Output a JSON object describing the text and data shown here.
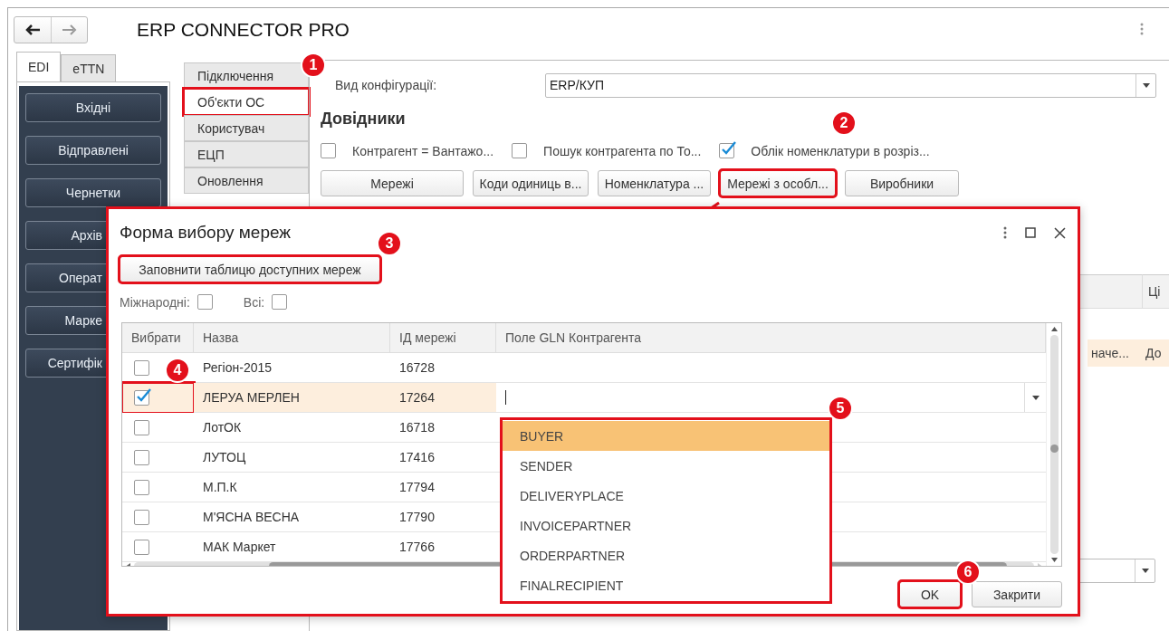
{
  "window": {
    "title": "ERP CONNECTOR PRO"
  },
  "top_tabs": [
    {
      "label": "EDI",
      "selected": true
    },
    {
      "label": "eTTN",
      "selected": false
    }
  ],
  "sidebar": {
    "items": [
      {
        "label": "Вхідні"
      },
      {
        "label": "Відправлені"
      },
      {
        "label": "Чернетки"
      },
      {
        "label": "Архів"
      },
      {
        "label": "Операт"
      },
      {
        "label": "Марке"
      },
      {
        "label": "Сертифік"
      }
    ]
  },
  "section_tabs": [
    {
      "label": "Підключення",
      "selected": false,
      "highlighted": false
    },
    {
      "label": "Об'єкти ОС",
      "selected": true,
      "highlighted": true
    },
    {
      "label": "Користувач",
      "selected": false,
      "highlighted": false
    },
    {
      "label": "ЕЦП",
      "selected": false,
      "highlighted": false
    },
    {
      "label": "Оновлення",
      "selected": false,
      "highlighted": false
    }
  ],
  "config": {
    "label": "Вид конфігурації:",
    "value": "ERP/КУП"
  },
  "directories": {
    "title": "Довідники",
    "options": [
      {
        "label": "Контрагент = Вантажо...",
        "checked": false
      },
      {
        "label": "Пошук контрагента по То...",
        "checked": false
      },
      {
        "label": "Облік номенклатури в розріз...",
        "checked": true
      }
    ],
    "buttons": [
      {
        "label": "Мережі",
        "highlighted": false
      },
      {
        "label": "Коди одиниць в...",
        "highlighted": false
      },
      {
        "label": "Номенклатура ...",
        "highlighted": false
      },
      {
        "label": "Мережі з особл...",
        "highlighted": true
      },
      {
        "label": "Виробники",
        "highlighted": false
      }
    ]
  },
  "background_table": {
    "column_2": "Ці",
    "row": {
      "column_1": "наче...",
      "column_2": "До"
    }
  },
  "dialog": {
    "title": "Форма вибору мереж",
    "fill_button": {
      "label": "Заповнити таблицю доступних мереж",
      "highlighted": true
    },
    "filters": [
      {
        "label": "Міжнародні:",
        "checked": false
      },
      {
        "label": "Всі:",
        "checked": false
      }
    ],
    "table": {
      "columns": [
        "Вибрати",
        "Назва",
        "ІД мережі",
        "Поле GLN Контрагента"
      ],
      "rows": [
        {
          "selected": false,
          "checked": false,
          "highlighted": false,
          "name": "Регіон-2015",
          "id": "16728"
        },
        {
          "selected": true,
          "checked": true,
          "highlighted": true,
          "name": "ЛЕРУА МЕРЛЕН",
          "id": "17264"
        },
        {
          "selected": false,
          "checked": false,
          "highlighted": false,
          "name": "ЛотОК",
          "id": "16718"
        },
        {
          "selected": false,
          "checked": false,
          "highlighted": false,
          "name": "ЛУТОЦ",
          "id": "17416"
        },
        {
          "selected": false,
          "checked": false,
          "highlighted": false,
          "name": "М.П.К",
          "id": "17794"
        },
        {
          "selected": false,
          "checked": false,
          "highlighted": false,
          "name": "М'ЯСНА ВЕСНА",
          "id": "17790"
        },
        {
          "selected": false,
          "checked": false,
          "highlighted": false,
          "name": "МАК Маркет",
          "id": "17766"
        }
      ]
    },
    "dropdown": {
      "highlighted": true,
      "items": [
        {
          "label": "BUYER",
          "selected": true
        },
        {
          "label": "SENDER",
          "selected": false
        },
        {
          "label": "DELIVERYPLACE",
          "selected": false
        },
        {
          "label": "INVOICEPARTNER",
          "selected": false
        },
        {
          "label": "ORDERPARTNER",
          "selected": false
        },
        {
          "label": "FINALRECIPIENT",
          "selected": false
        }
      ]
    },
    "buttons": [
      {
        "label": "OK",
        "highlighted": true
      },
      {
        "label": "Закрити",
        "highlighted": false
      }
    ]
  },
  "annotations": {
    "badges": [
      "1",
      "2",
      "3",
      "4",
      "5",
      "6"
    ]
  }
}
